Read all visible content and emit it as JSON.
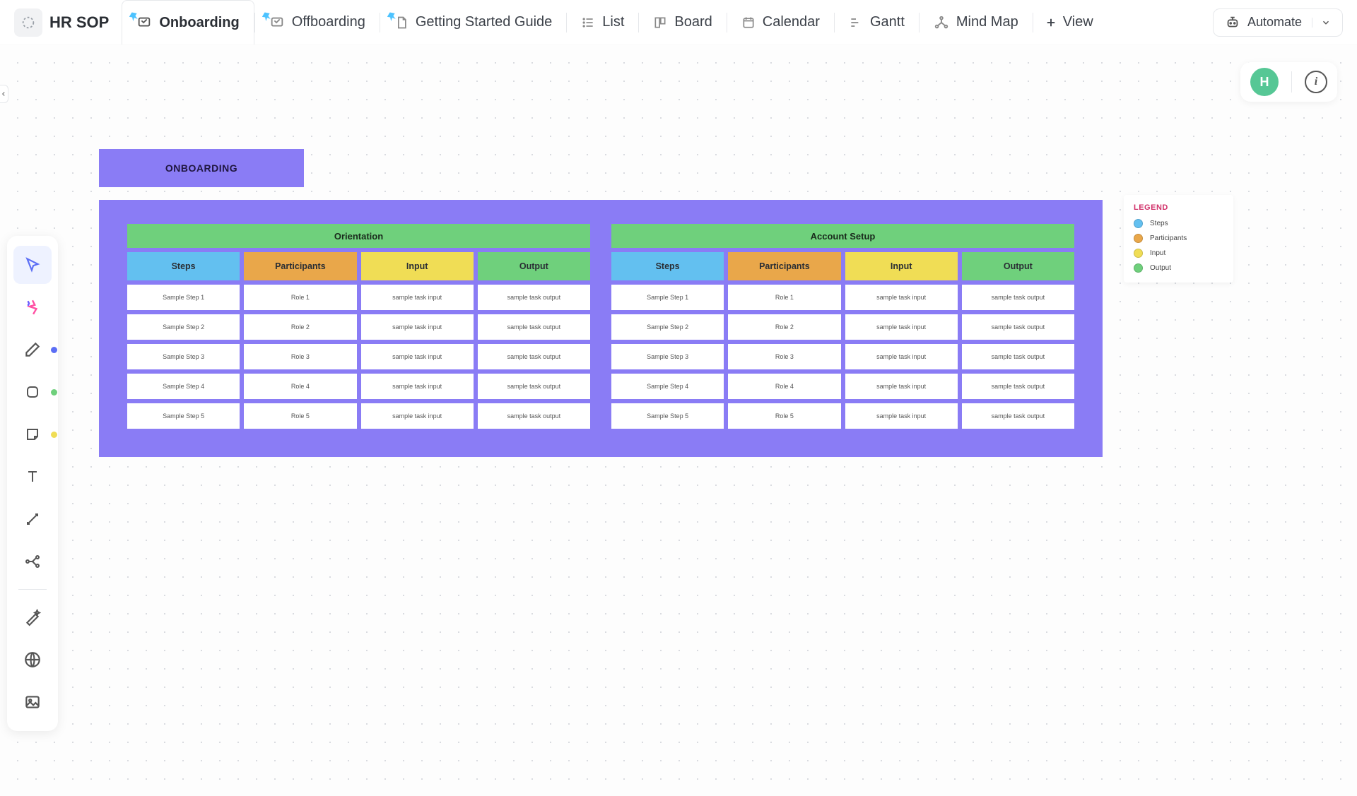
{
  "header": {
    "title": "HR SOP",
    "tabs": [
      {
        "label": "Onboarding",
        "kind": "whiteboard",
        "pinned": true,
        "active": true
      },
      {
        "label": "Offboarding",
        "kind": "whiteboard",
        "pinned": true,
        "active": false
      },
      {
        "label": "Getting Started Guide",
        "kind": "doc",
        "pinned": true,
        "active": false
      },
      {
        "label": "List",
        "kind": "list",
        "pinned": false,
        "active": false
      },
      {
        "label": "Board",
        "kind": "board",
        "pinned": false,
        "active": false
      },
      {
        "label": "Calendar",
        "kind": "calendar",
        "pinned": false,
        "active": false
      },
      {
        "label": "Gantt",
        "kind": "gantt",
        "pinned": false,
        "active": false
      },
      {
        "label": "Mind Map",
        "kind": "mindmap",
        "pinned": false,
        "active": false
      }
    ],
    "add_view_label": "View",
    "automate_label": "Automate"
  },
  "canvas": {
    "avatar_letter": "H"
  },
  "board": {
    "title": "ONBOARDING",
    "columns": [
      "Steps",
      "Participants",
      "Input",
      "Output"
    ],
    "sections": [
      {
        "name": "Orientation",
        "rows": [
          [
            "Sample Step 1",
            "Role 1",
            "sample task input",
            "sample task output"
          ],
          [
            "Sample Step 2",
            "Role 2",
            "sample task input",
            "sample task output"
          ],
          [
            "Sample Step 3",
            "Role 3",
            "sample task input",
            "sample task output"
          ],
          [
            "Sample Step 4",
            "Role 4",
            "sample task input",
            "sample task output"
          ],
          [
            "Sample Step 5",
            "Role 5",
            "sample task input",
            "sample task output"
          ]
        ]
      },
      {
        "name": "Account Setup",
        "rows": [
          [
            "Sample Step 1",
            "Role 1",
            "sample task input",
            "sample task output"
          ],
          [
            "Sample Step 2",
            "Role 2",
            "sample task input",
            "sample task output"
          ],
          [
            "Sample Step 3",
            "Role 3",
            "sample task input",
            "sample task output"
          ],
          [
            "Sample Step 4",
            "Role 4",
            "sample task input",
            "sample task output"
          ],
          [
            "Sample Step 5",
            "Role 5",
            "sample task input",
            "sample task output"
          ]
        ]
      }
    ]
  },
  "legend": {
    "title": "LEGEND",
    "items": [
      {
        "label": "Steps",
        "color": "#63c0f0"
      },
      {
        "label": "Participants",
        "color": "#e9a74a"
      },
      {
        "label": "Input",
        "color": "#f0dd55"
      },
      {
        "label": "Output",
        "color": "#6fd07c"
      }
    ]
  },
  "colors": {
    "canvas_purple": "#8a7cf5",
    "green": "#6fd07c",
    "blue": "#63c0f0",
    "orange": "#e9a74a",
    "yellow": "#f0dd55",
    "avatar": "#56c795"
  }
}
